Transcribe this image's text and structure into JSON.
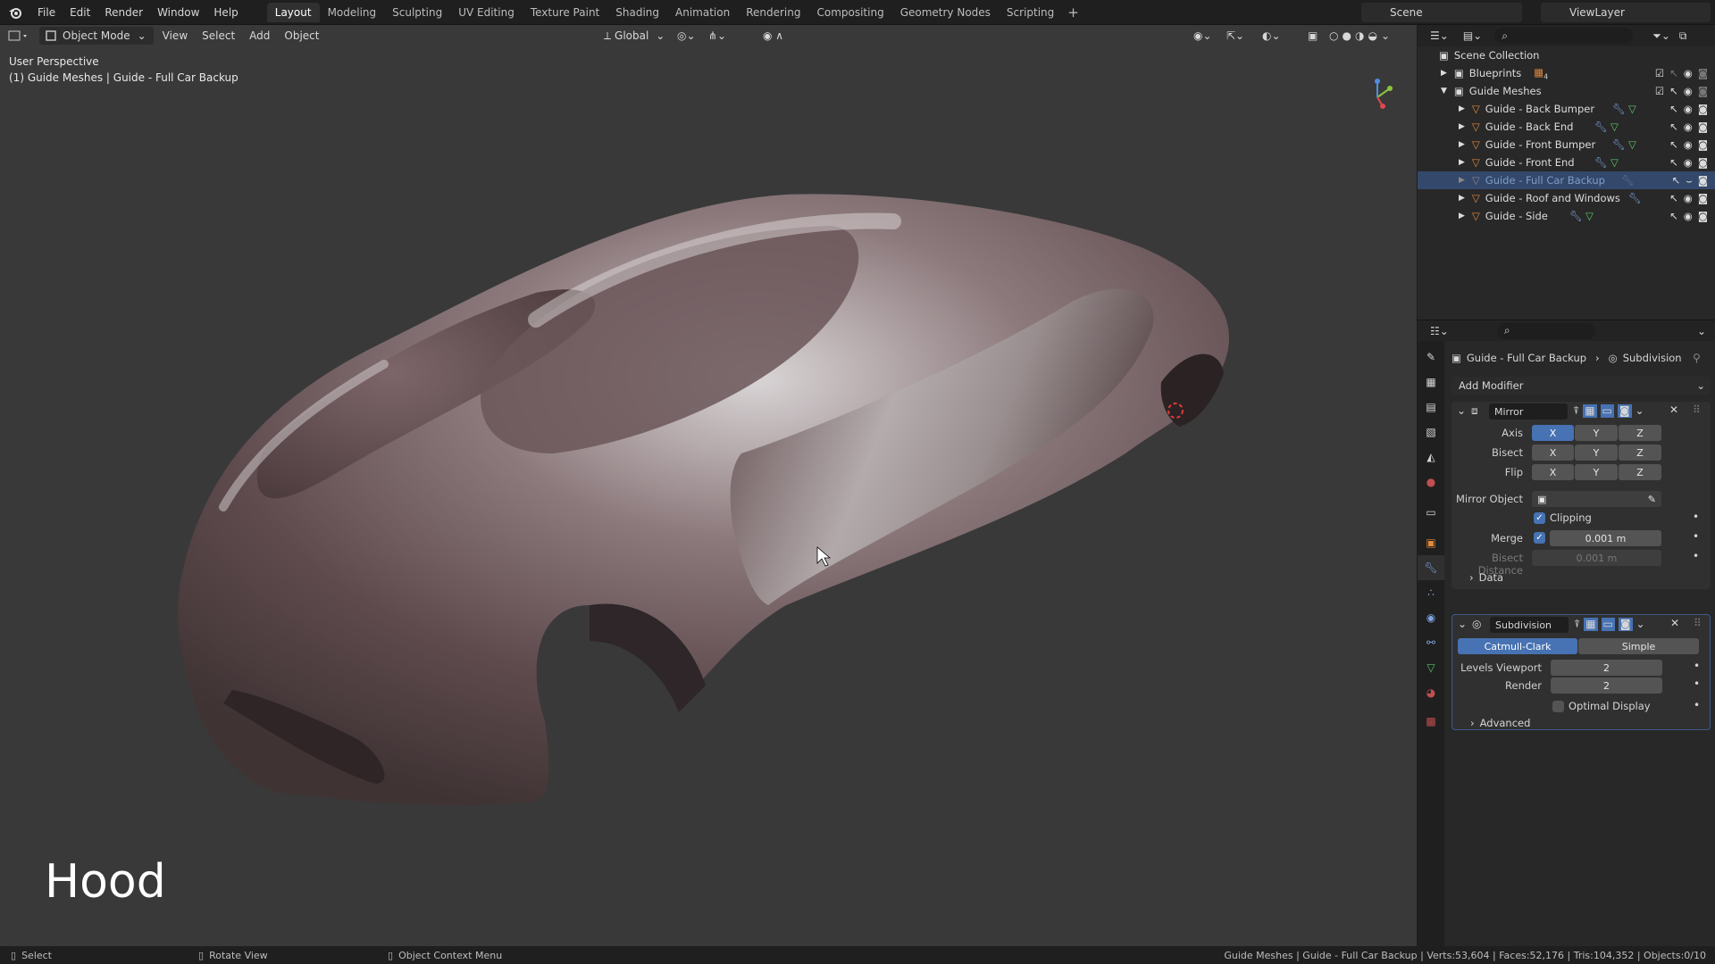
{
  "menu": [
    "File",
    "Edit",
    "Render",
    "Window",
    "Help"
  ],
  "workspaces": [
    "Layout",
    "Modeling",
    "Sculpting",
    "UV Editing",
    "Texture Paint",
    "Shading",
    "Animation",
    "Rendering",
    "Compositing",
    "Geometry Nodes",
    "Scripting"
  ],
  "active_workspace": "Layout",
  "scene_name": "Scene",
  "view_layer": "ViewLayer",
  "viewport": {
    "mode": "Object Mode",
    "menus": [
      "View",
      "Select",
      "Add",
      "Object"
    ],
    "transform": "Global",
    "perspective": "User Perspective",
    "context": "(1) Guide Meshes | Guide - Full Car Backup",
    "caption": "Hood"
  },
  "outliner": {
    "root": "Scene Collection",
    "collections": [
      "Blueprints",
      "Guide Meshes"
    ],
    "blueprints_count": "4",
    "objects": [
      "Guide - Back Bumper",
      "Guide - Back End",
      "Guide - Front Bumper",
      "Guide - Front End",
      "Guide - Full Car Backup",
      "Guide - Roof and Windows",
      "Guide - Side"
    ],
    "selected": "Guide - Full Car Backup"
  },
  "properties": {
    "breadcrumb_object": "Guide - Full Car Backup",
    "breadcrumb_modifier": "Subdivision",
    "add_modifier": "Add Modifier",
    "mirror": {
      "name": "Mirror",
      "axis_label": "Axis",
      "bisect_label": "Bisect",
      "flip_label": "Flip",
      "x": "X",
      "y": "Y",
      "z": "Z",
      "mirror_object_label": "Mirror Object",
      "clipping_label": "Clipping",
      "merge_label": "Merge",
      "merge_value": "0.001 m",
      "bisect_distance_label": "Bisect Distance",
      "bisect_distance_value": "0.001 m",
      "data_label": "Data"
    },
    "subdivision": {
      "name": "Subdivision",
      "catmull": "Catmull-Clark",
      "simple": "Simple",
      "levels_viewport_label": "Levels Viewport",
      "levels_viewport": "2",
      "render_label": "Render",
      "render": "2",
      "optimal_label": "Optimal Display",
      "advanced_label": "Advanced"
    }
  },
  "status": {
    "select": "Select",
    "rotate": "Rotate View",
    "context_menu": "Object Context Menu",
    "stats": "Guide Meshes | Guide - Full Car Backup | Verts:53,604 | Faces:52,176 | Tris:104,352 | Objects:0/10"
  },
  "colors": {
    "accent": "#4772b3",
    "viewport_bg": "#393939",
    "selected_row": "#33486a",
    "object_icon": "#e08a3c"
  }
}
